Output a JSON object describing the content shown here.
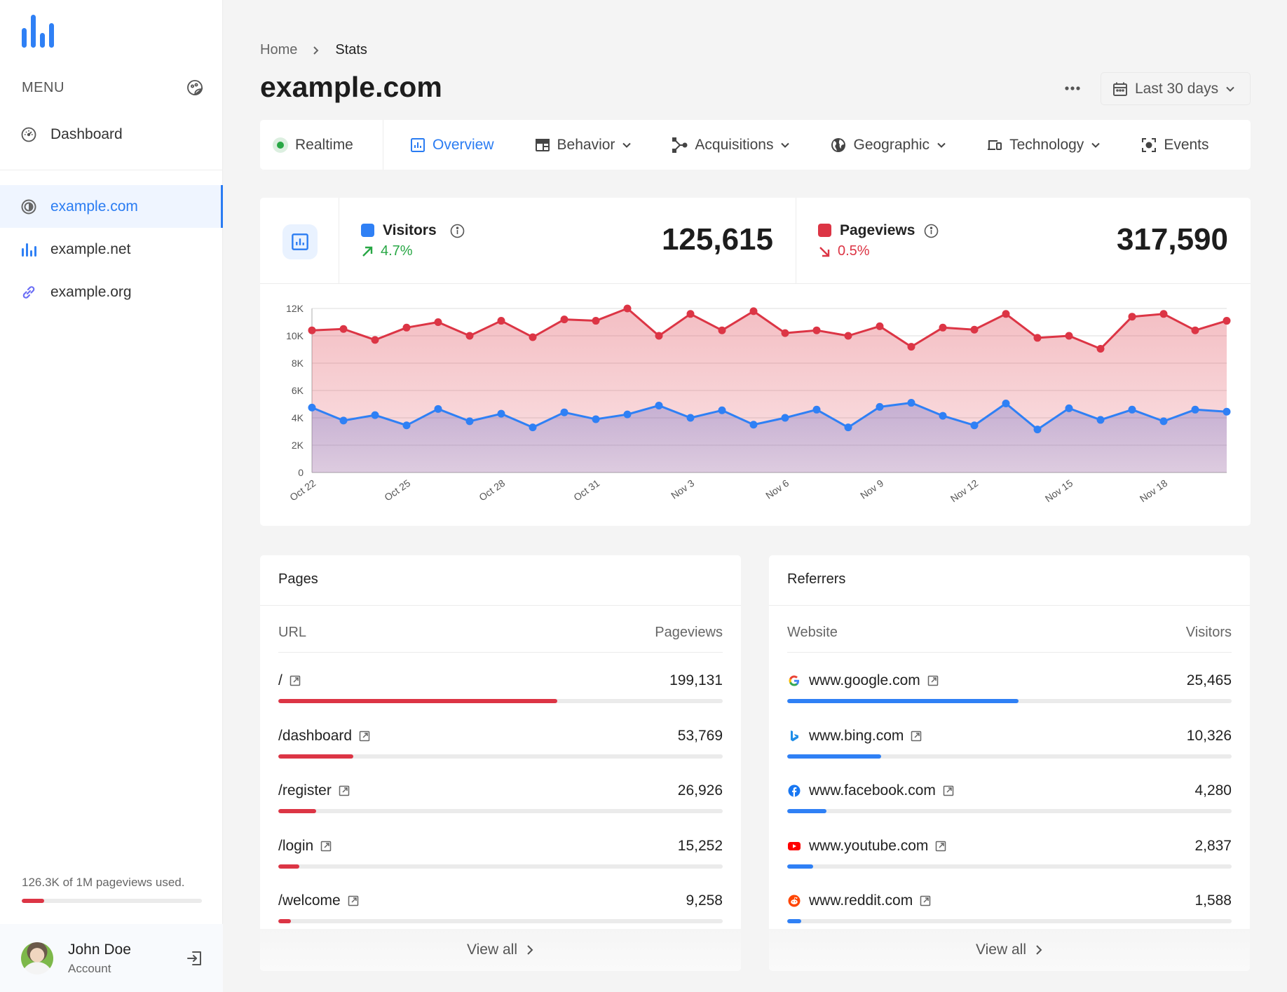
{
  "colors": {
    "accent": "#2a7cf2",
    "visitors": "#2f80f5",
    "pageviews": "#dc3545",
    "positive": "#28a745",
    "negative": "#dc3545"
  },
  "sidebar": {
    "logo": "bar-chart-logo",
    "menu_title": "MENU",
    "menu_icon": "palette-icon",
    "items": [
      {
        "label": "Dashboard",
        "icon": "gauge-icon",
        "active": false
      },
      {
        "label": "example.com",
        "icon": "circle-half-icon",
        "active": true
      },
      {
        "label": "example.net",
        "icon": "bar-chart-icon",
        "active": false
      },
      {
        "label": "example.org",
        "icon": "link-icon",
        "active": false
      }
    ],
    "usage": {
      "text": "126.3K of 1M pageviews used.",
      "used": 126300,
      "limit": 1000000,
      "fraction": 0.1263
    },
    "account": {
      "name": "John Doe",
      "subtitle": "Account",
      "logout_icon": "logout-icon"
    }
  },
  "header": {
    "breadcrumb": [
      {
        "label": "Home"
      },
      {
        "label": "Stats"
      }
    ],
    "title": "example.com",
    "more_icon": "more-horizontal-icon",
    "date_range": "Last 30 days"
  },
  "tabs": [
    {
      "label": "Realtime",
      "icon": "live-dot-icon",
      "dropdown": false,
      "active": false
    },
    {
      "label": "Overview",
      "icon": "chart-square-icon",
      "dropdown": false,
      "active": true
    },
    {
      "label": "Behavior",
      "icon": "layout-icon",
      "dropdown": true,
      "active": false
    },
    {
      "label": "Acquisitions",
      "icon": "share-icon",
      "dropdown": true,
      "active": false
    },
    {
      "label": "Geographic",
      "icon": "globe-icon",
      "dropdown": true,
      "active": false
    },
    {
      "label": "Technology",
      "icon": "devices-icon",
      "dropdown": true,
      "active": false
    },
    {
      "label": "Events",
      "icon": "target-icon",
      "dropdown": false,
      "active": false
    }
  ],
  "stats": {
    "visitors": {
      "label": "Visitors",
      "value": "125,615",
      "change": "4.7%",
      "trend": "up"
    },
    "pageviews": {
      "label": "Pageviews",
      "value": "317,590",
      "change": "0.5%",
      "trend": "down"
    }
  },
  "chart_data": {
    "type": "area",
    "title": "",
    "xlabel": "",
    "ylabel": "",
    "ylim": [
      0,
      12000
    ],
    "y_ticks": [
      0,
      2000,
      4000,
      6000,
      8000,
      10000,
      12000
    ],
    "y_tick_labels": [
      "0",
      "2K",
      "4K",
      "6K",
      "8K",
      "10K",
      "12K"
    ],
    "grid": true,
    "x": [
      "Oct 22",
      "Oct 23",
      "Oct 24",
      "Oct 25",
      "Oct 26",
      "Oct 27",
      "Oct 28",
      "Oct 29",
      "Oct 30",
      "Oct 31",
      "Nov 1",
      "Nov 2",
      "Nov 3",
      "Nov 4",
      "Nov 5",
      "Nov 6",
      "Nov 7",
      "Nov 8",
      "Nov 9",
      "Nov 10",
      "Nov 11",
      "Nov 12",
      "Nov 13",
      "Nov 14",
      "Nov 15",
      "Nov 16",
      "Nov 17",
      "Nov 18",
      "Nov 19",
      "Nov 20"
    ],
    "x_tick_labels": [
      "Oct 22",
      "Oct 25",
      "Oct 28",
      "Oct 31",
      "Nov 3",
      "Nov 6",
      "Nov 9",
      "Nov 12",
      "Nov 15",
      "Nov 18"
    ],
    "series": [
      {
        "name": "Pageviews",
        "color": "#dc3545",
        "values": [
          10400,
          10500,
          9700,
          10600,
          11000,
          10000,
          11100,
          9900,
          11200,
          11100,
          12000,
          10000,
          11600,
          10400,
          11800,
          10200,
          10400,
          10000,
          10700,
          9200,
          10600,
          10450,
          11600,
          9850,
          10000,
          9050,
          11400,
          11600,
          10400,
          11100
        ]
      },
      {
        "name": "Visitors",
        "color": "#2f80f5",
        "values": [
          4750,
          3800,
          4200,
          3450,
          4650,
          3750,
          4300,
          3300,
          4400,
          3900,
          4250,
          4900,
          4000,
          4550,
          3500,
          4000,
          4600,
          3300,
          4800,
          5100,
          4150,
          3450,
          5050,
          3150,
          4700,
          3850,
          4600,
          3750,
          4600,
          4450
        ]
      }
    ]
  },
  "pages": {
    "title": "Pages",
    "col_left": "URL",
    "col_right": "Pageviews",
    "rows": [
      {
        "label": "/",
        "value": "199,131",
        "share": 0.627
      },
      {
        "label": "/dashboard",
        "value": "53,769",
        "share": 0.169
      },
      {
        "label": "/register",
        "value": "26,926",
        "share": 0.085
      },
      {
        "label": "/login",
        "value": "15,252",
        "share": 0.048
      },
      {
        "label": "/welcome",
        "value": "9,258",
        "share": 0.029
      }
    ],
    "view_all": "View all"
  },
  "referrers": {
    "title": "Referrers",
    "col_left": "Website",
    "col_right": "Visitors",
    "rows": [
      {
        "label": "www.google.com",
        "icon": "google-icon",
        "value": "25,465",
        "share": 0.52
      },
      {
        "label": "www.bing.com",
        "icon": "bing-icon",
        "value": "10,326",
        "share": 0.211
      },
      {
        "label": "www.facebook.com",
        "icon": "facebook-icon",
        "value": "4,280",
        "share": 0.088
      },
      {
        "label": "www.youtube.com",
        "icon": "youtube-icon",
        "value": "2,837",
        "share": 0.058
      },
      {
        "label": "www.reddit.com",
        "icon": "reddit-icon",
        "value": "1,588",
        "share": 0.032
      }
    ],
    "view_all": "View all"
  }
}
